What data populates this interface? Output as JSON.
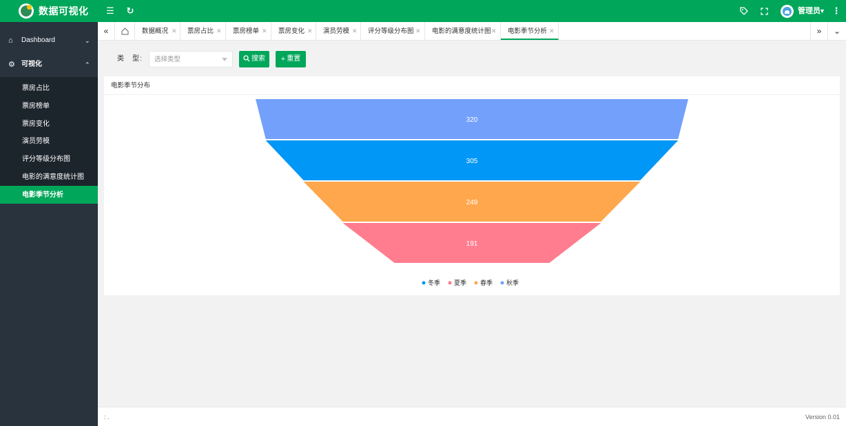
{
  "app": {
    "title": "数据可视化"
  },
  "header": {
    "user_name": "管理员",
    "icons": [
      "menu-icon",
      "refresh-icon",
      "tag-icon",
      "fullscreen-icon",
      "avatar",
      "more-icon"
    ]
  },
  "sidebar": {
    "dashboard_label": "Dashboard",
    "visual_label": "可视化",
    "items": [
      {
        "label": "票房占比",
        "active": false
      },
      {
        "label": "票房榜单",
        "active": false
      },
      {
        "label": "票房变化",
        "active": false
      },
      {
        "label": "演员劳模",
        "active": false
      },
      {
        "label": "评分等级分布图",
        "active": false
      },
      {
        "label": "电影的满意度统计图",
        "active": false
      },
      {
        "label": "电影季节分析",
        "active": true
      }
    ]
  },
  "tabs": [
    {
      "label": "数据概况"
    },
    {
      "label": "票房占比"
    },
    {
      "label": "票房榜单"
    },
    {
      "label": "票房变化"
    },
    {
      "label": "演员劳模"
    },
    {
      "label": "评分等级分布图"
    },
    {
      "label": "电影的满意度统计图"
    },
    {
      "label": "电影季节分析",
      "active": true
    }
  ],
  "filter": {
    "type_label": "类　型:",
    "select_placeholder": "选择类型",
    "search_label": "搜索",
    "reset_label": "重置"
  },
  "card": {
    "title": "电影季节分布"
  },
  "footer": {
    "left": ": .",
    "version": "Version 0.01"
  },
  "colors": {
    "accent": "#00a65a",
    "sidebar": "#28333e",
    "submenu": "#1c242c"
  },
  "chart_data": {
    "type": "funnel",
    "title": "",
    "series": [
      {
        "name": "秋季",
        "value": 320,
        "color": "#73a0fa"
      },
      {
        "name": "冬季",
        "value": 305,
        "color": "#0097f6"
      },
      {
        "name": "春季",
        "value": 249,
        "color": "#ffa74c"
      },
      {
        "name": "夏季",
        "value": 191,
        "color": "#ff7d8f"
      }
    ],
    "legend": [
      "冬季",
      "夏季",
      "春季",
      "秋季"
    ],
    "legend_position": "bottom",
    "sort": "descending"
  }
}
